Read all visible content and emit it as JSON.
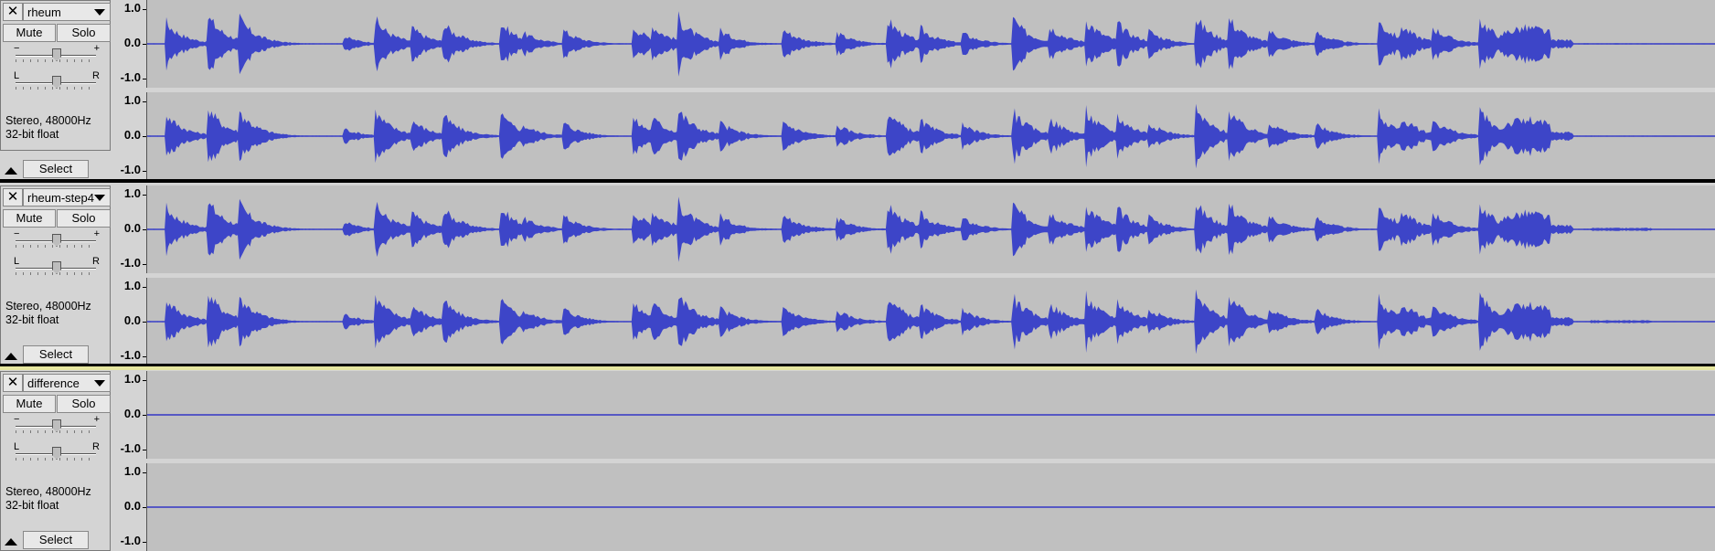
{
  "colors": {
    "panel_bg": "#d4d4d4",
    "wave_bg": "#c0c0c0",
    "waveform": "#3d45c8",
    "baseline": "#3236c6",
    "focus_border": "#e7e7a0"
  },
  "icons": {
    "close": "close-icon",
    "menu": "chevron-down-icon",
    "collapse": "collapse-triangle-icon",
    "gain": "gain-slider-icon",
    "pan": "pan-slider-icon"
  },
  "tracks": [
    {
      "name": "rheum",
      "mute_label": "Mute",
      "solo_label": "Solo",
      "gain_minus": "−",
      "gain_plus": "+",
      "pan_left": "L",
      "pan_right": "R",
      "info_line1": "Stereo, 48000Hz",
      "info_line2": "32-bit float",
      "select_label": "Select",
      "scale": [
        "1.0",
        "0.0",
        "-1.0"
      ],
      "silent": false,
      "tail": false
    },
    {
      "name": "rheum-step4",
      "mute_label": "Mute",
      "solo_label": "Solo",
      "gain_minus": "−",
      "gain_plus": "+",
      "pan_left": "L",
      "pan_right": "R",
      "info_line1": "Stereo, 48000Hz",
      "info_line2": "32-bit float",
      "select_label": "Select",
      "scale": [
        "1.0",
        "0.0",
        "-1.0"
      ],
      "silent": false,
      "tail": true
    },
    {
      "name": "difference",
      "mute_label": "Mute",
      "solo_label": "Solo",
      "gain_minus": "−",
      "gain_plus": "+",
      "pan_left": "L",
      "pan_right": "R",
      "info_line1": "Stereo, 48000Hz",
      "info_line2": "32-bit float",
      "select_label": "Select",
      "scale": [
        "1.0",
        "0.0",
        "-1.0"
      ],
      "silent": true,
      "tail": false
    }
  ]
}
